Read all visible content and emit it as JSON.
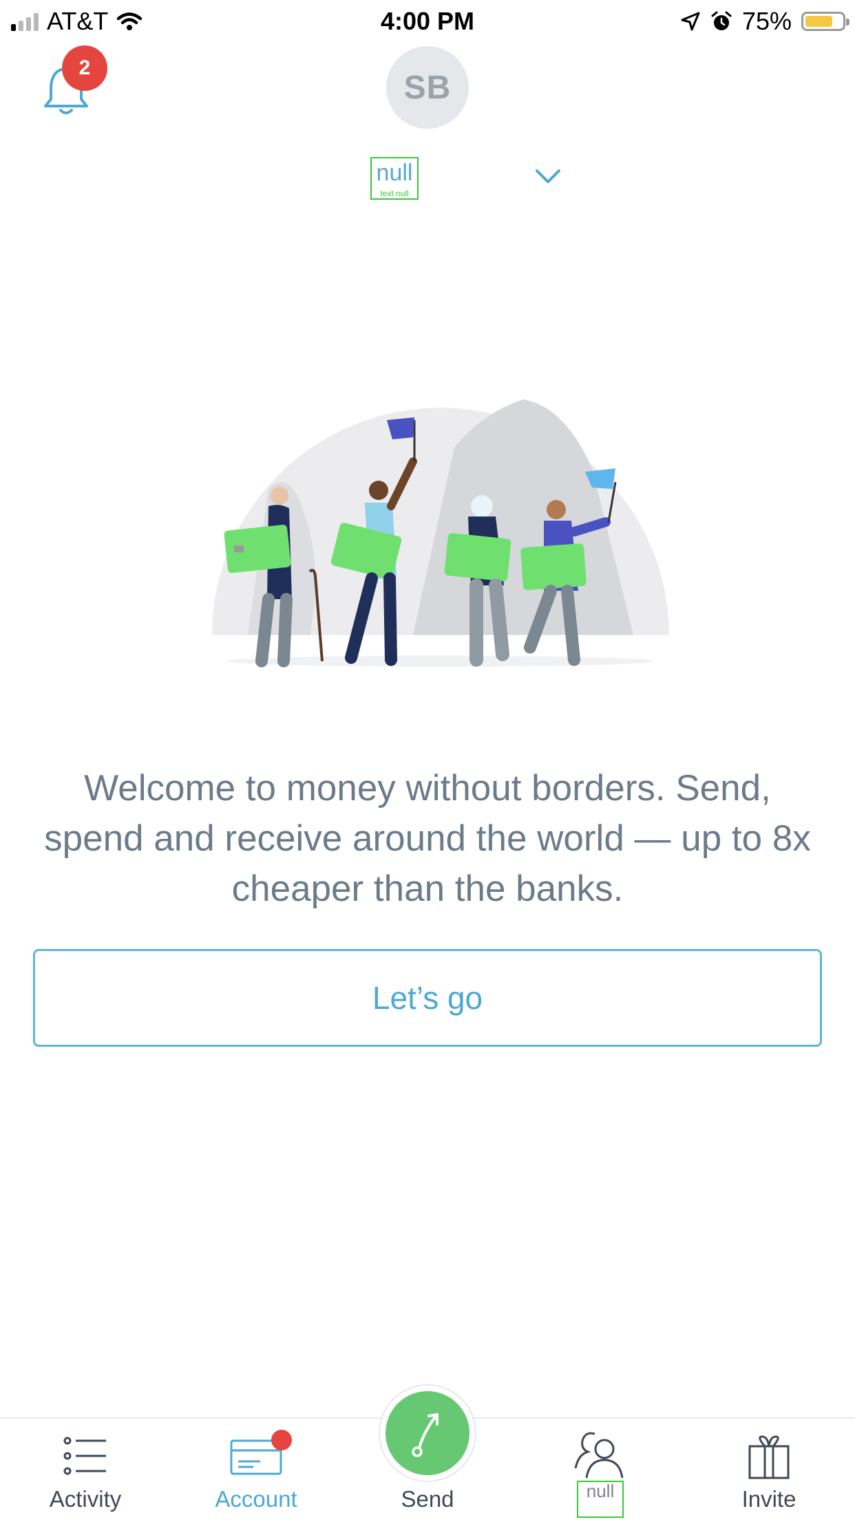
{
  "status_bar": {
    "carrier": "AT&T",
    "time": "4:00 PM",
    "battery": "75%",
    "battery_level": 0.75,
    "battery_color": "#f5c842"
  },
  "header": {
    "notification_count": "2",
    "badge_color": "#e5453f",
    "avatar_initials": "SB",
    "account_name": "null",
    "account_subtitle": "text null"
  },
  "main": {
    "welcome_text": "Welcome to money without borders. Send, spend and receive around the world — up to 8x cheaper than the banks.",
    "cta_label": "Let’s go"
  },
  "tabbar": {
    "tabs": [
      {
        "label": "Activity",
        "icon": "list-icon"
      },
      {
        "label": "Account",
        "icon": "card-icon",
        "active": true
      },
      {
        "label": "Send",
        "icon": "send-arrow-icon"
      },
      {
        "label": "null",
        "icon": "recipients-icon"
      },
      {
        "label": "Invite",
        "icon": "gift-icon"
      }
    ],
    "active_color": "#4ba9d3",
    "send_color": "#66c872",
    "account_dot_color": "#e5453f"
  },
  "colors": {
    "accent": "#4ba9d3",
    "text": "#6b7b89",
    "card_green": "#6fe06f"
  }
}
